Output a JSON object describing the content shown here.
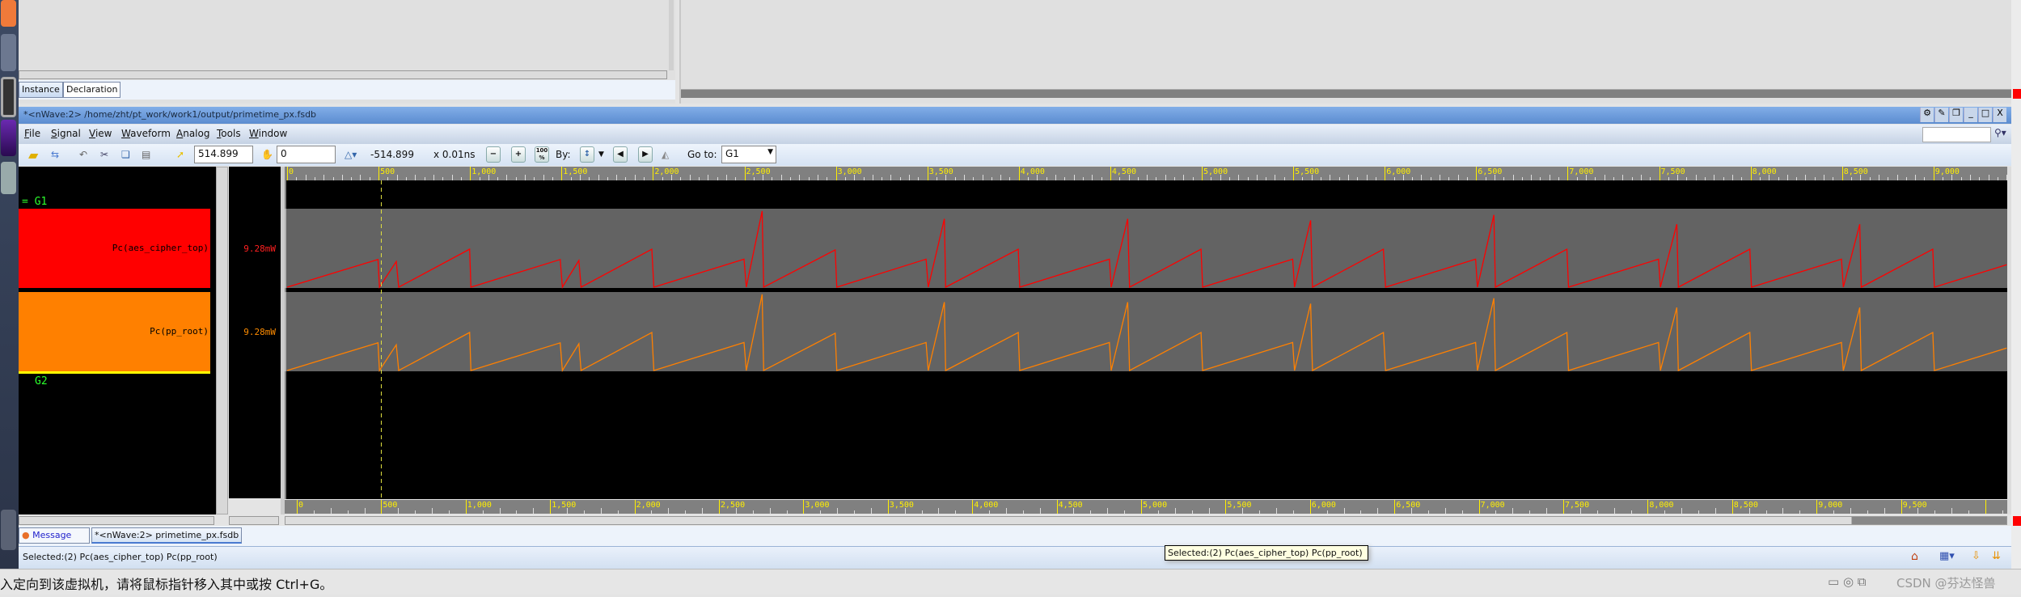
{
  "top_panel": {
    "tabs": [
      {
        "label": "Instance",
        "active": true
      },
      {
        "label": "Declaration",
        "active": false
      }
    ]
  },
  "window": {
    "title": "*<nWave:2> /home/zht/pt_work/work1/output/primetime_px.fsdb",
    "buttons": [
      "gear-icon",
      "pin-icon",
      "restore-icon",
      "minimize-icon",
      "maximize-icon",
      "close-icon"
    ],
    "close_label": "X"
  },
  "menu": [
    "File",
    "Signal",
    "View",
    "Waveform",
    "Analog",
    "Tools",
    "Window"
  ],
  "toolbar": {
    "cursor_time": "514.899",
    "marker_time": "0",
    "delta": "-514.899",
    "unit": "x 0.01ns",
    "zoom100": "100 %",
    "by_label": "By:",
    "goto_label": "Go to:",
    "goto_value": "G1"
  },
  "groups": [
    {
      "name": "G1"
    },
    {
      "name": "G2"
    }
  ],
  "signals": [
    {
      "name": "Pc(aes_cipher_top)",
      "value": "9.28mW",
      "color": "#ff0000"
    },
    {
      "name": "Pc(pp_root)",
      "value": "9.28mW",
      "color": "#ff8000"
    }
  ],
  "ruler_top": {
    "labels": [
      "0",
      "500",
      "1,000",
      "1,500",
      "2,000",
      "2,500",
      "3,000",
      "3,500",
      "4,000",
      "4,500",
      "5,000",
      "5,500",
      "6,000",
      "6,500",
      "7,000",
      "7,500",
      "8,000",
      "8,500",
      "9,000"
    ],
    "step": 500,
    "minor": 50
  },
  "ruler_bottom": {
    "labels": [
      "0",
      "500",
      "1,000",
      "1,500",
      "2,000",
      "2,500",
      "3,000",
      "3,500",
      "4,000",
      "4,500",
      "5,000",
      "5,500",
      "6,000",
      "6,500",
      "7,000",
      "7,500",
      "8,000",
      "8,500",
      "9,000",
      "9,500"
    ],
    "step": 500,
    "minor": 100
  },
  "cursor_time": 514.899,
  "waveform": {
    "time_unit": "x 0.01ns",
    "points": [
      [
        0,
        0
      ],
      [
        497,
        0.356
      ],
      [
        505,
        0
      ],
      [
        597,
        0.33
      ],
      [
        610,
        0
      ],
      [
        998,
        0.49
      ],
      [
        1005,
        0
      ],
      [
        1493,
        0.356
      ],
      [
        1505,
        0
      ],
      [
        1595,
        0.345
      ],
      [
        1607,
        0
      ],
      [
        1994,
        0.49
      ],
      [
        2005,
        0
      ],
      [
        2498,
        0.36
      ],
      [
        2510,
        0
      ],
      [
        2597,
        0.98
      ],
      [
        2605,
        0
      ],
      [
        2996,
        0.48
      ],
      [
        3005,
        0
      ],
      [
        3493,
        0.36
      ],
      [
        3505,
        0
      ],
      [
        3593,
        0.88
      ],
      [
        3600,
        0
      ],
      [
        3997,
        0.49
      ],
      [
        4005,
        0
      ],
      [
        4495,
        0.36
      ],
      [
        4505,
        0
      ],
      [
        4595,
        0.88
      ],
      [
        4605,
        0
      ],
      [
        4996,
        0.49
      ],
      [
        5005,
        0
      ],
      [
        5497,
        0.36
      ],
      [
        5507,
        0
      ],
      [
        5595,
        0.86
      ],
      [
        5605,
        0
      ],
      [
        5993,
        0.49
      ],
      [
        6005,
        0
      ],
      [
        6497,
        0.36
      ],
      [
        6507,
        0
      ],
      [
        6597,
        0.93
      ],
      [
        6605,
        0
      ],
      [
        6996,
        0.49
      ],
      [
        7005,
        0
      ],
      [
        7497,
        0.36
      ],
      [
        7507,
        0
      ],
      [
        7597,
        0.81
      ],
      [
        7605,
        0
      ],
      [
        7996,
        0.49
      ],
      [
        8005,
        0
      ],
      [
        8497,
        0.36
      ],
      [
        8507,
        0
      ],
      [
        8597,
        0.81
      ],
      [
        8605,
        0
      ],
      [
        8996,
        0.49
      ],
      [
        9005,
        0
      ],
      [
        9400,
        0.29
      ]
    ]
  },
  "bottom_tabs": [
    {
      "label": "Message"
    },
    {
      "label": "*<nWave:2> primetime_px.fsdb"
    }
  ],
  "status": {
    "text": "Selected:(2) Pc(aes_cipher_top) Pc(pp_root)",
    "tooltip": "Selected:(2) Pc(aes_cipher_top) Pc(pp_root)"
  },
  "host": {
    "message": "入定向到该虚拟机，请将鼠标指针移入其中或按 Ctrl+G。",
    "watermark": "CSDN @芬达怪兽"
  }
}
